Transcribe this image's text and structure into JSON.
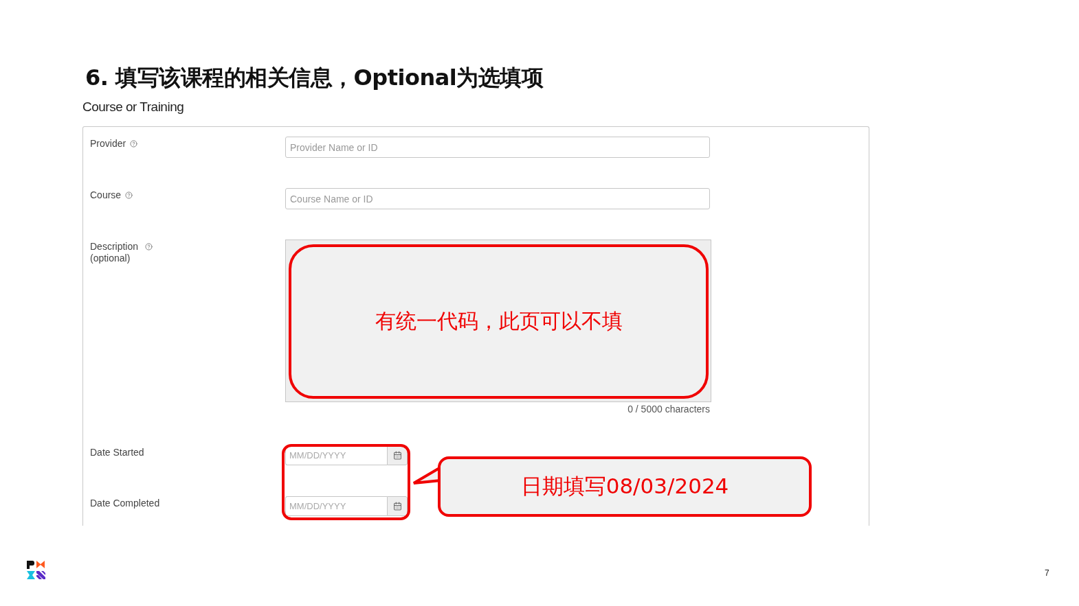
{
  "slide": {
    "title": "6. 填写该课程的相关信息，Optional为选填项",
    "section_title": "Course or Training",
    "page_number": "7"
  },
  "form": {
    "fields": [
      {
        "kind": "text",
        "label": "Provider",
        "help": true,
        "placeholder": "Provider Name or ID"
      },
      {
        "kind": "text",
        "label": "Course",
        "help": true,
        "placeholder": "Course Name or ID"
      },
      {
        "kind": "textarea",
        "label": "Description",
        "sublabel": "(optional)",
        "help": true,
        "counter": "0 / 5000 characters"
      },
      {
        "kind": "date",
        "label": "Date Started",
        "help": false,
        "placeholder": "MM/DD/YYYY"
      },
      {
        "kind": "date",
        "label": "Date Completed",
        "help": false,
        "placeholder": "MM/DD/YYYY"
      }
    ]
  },
  "annotations": [
    {
      "kind": "box",
      "text": "有统一代码，此页可以不填"
    },
    {
      "kind": "outline"
    },
    {
      "kind": "bubble",
      "text": "日期填写08/03/2024"
    }
  ]
}
